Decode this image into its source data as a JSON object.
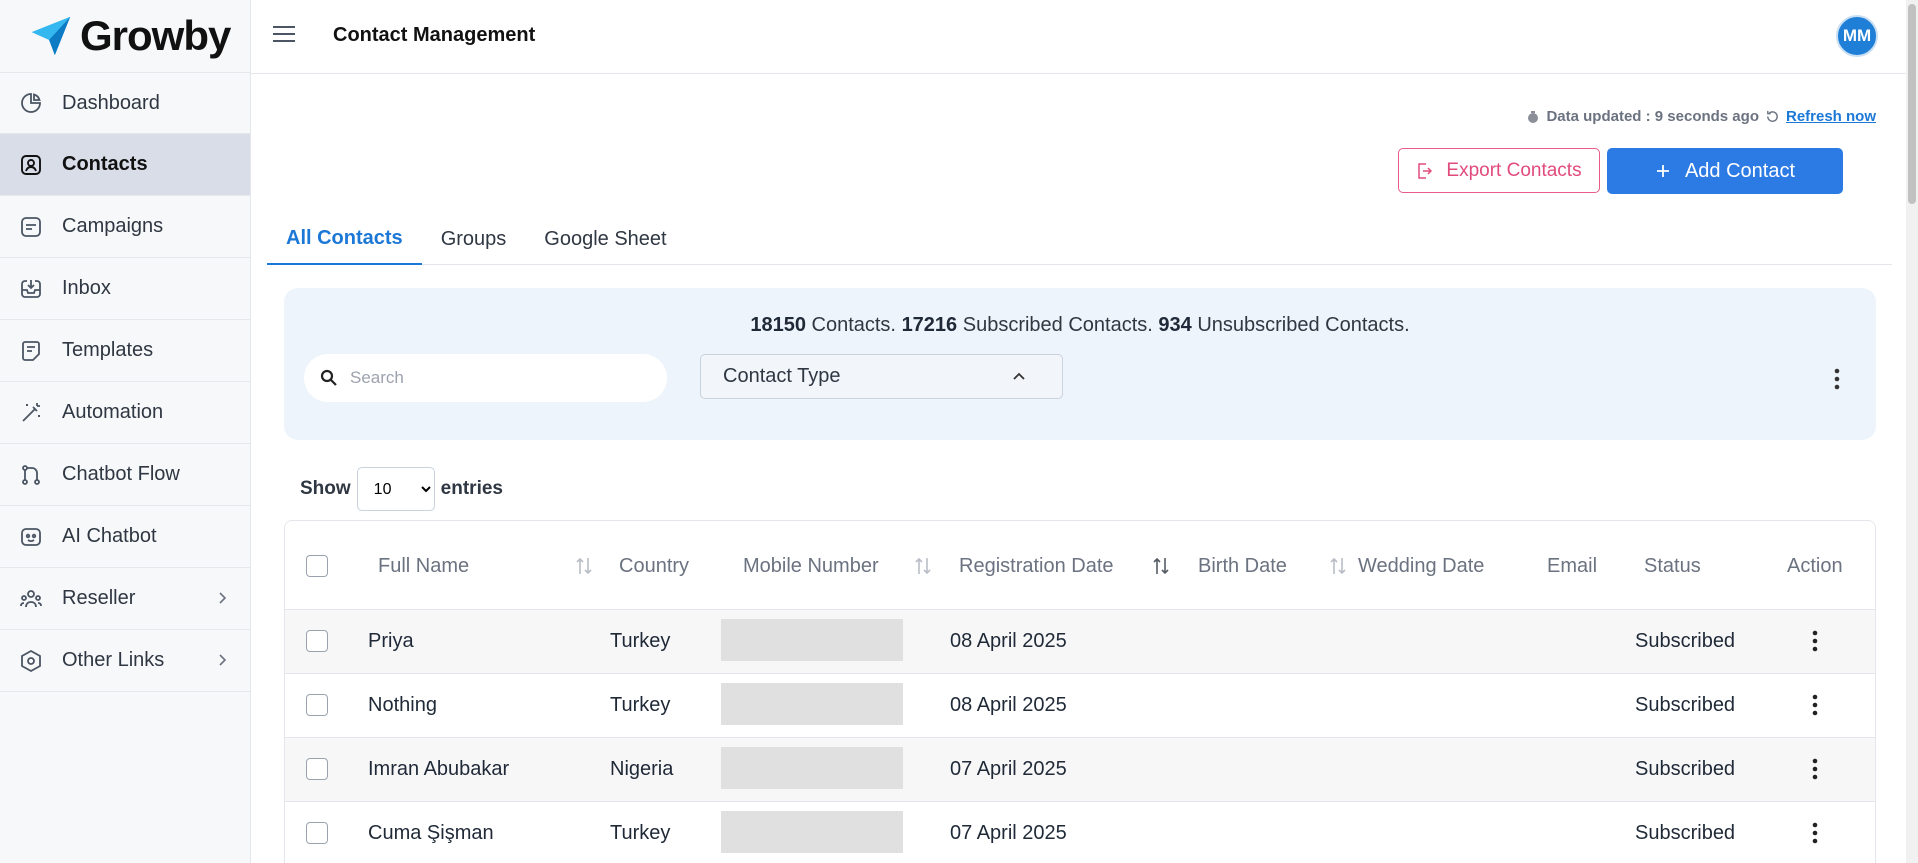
{
  "brand": {
    "name": "Growby"
  },
  "sidebar": {
    "items": [
      {
        "label": "Dashboard",
        "icon": "pie-chart-icon",
        "active": false,
        "has_submenu": false
      },
      {
        "label": "Contacts",
        "icon": "contact-card-icon",
        "active": true,
        "has_submenu": false
      },
      {
        "label": "Campaigns",
        "icon": "campaign-icon",
        "active": false,
        "has_submenu": false
      },
      {
        "label": "Inbox",
        "icon": "inbox-icon",
        "active": false,
        "has_submenu": false
      },
      {
        "label": "Templates",
        "icon": "template-icon",
        "active": false,
        "has_submenu": false
      },
      {
        "label": "Automation",
        "icon": "magic-wand-icon",
        "active": false,
        "has_submenu": false
      },
      {
        "label": "Chatbot Flow",
        "icon": "flow-icon",
        "active": false,
        "has_submenu": false
      },
      {
        "label": "AI Chatbot",
        "icon": "robot-icon",
        "active": false,
        "has_submenu": false
      },
      {
        "label": "Reseller",
        "icon": "users-icon",
        "active": false,
        "has_submenu": true
      },
      {
        "label": "Other Links",
        "icon": "hexagon-icon",
        "active": false,
        "has_submenu": true
      }
    ]
  },
  "header": {
    "title": "Contact Management",
    "avatar_initials": "MM"
  },
  "status": {
    "updated_text": "Data updated : 9 seconds ago",
    "refresh_label": "Refresh now"
  },
  "actions": {
    "export_label": "Export Contacts",
    "add_label": "Add Contact"
  },
  "tabs": [
    {
      "label": "All Contacts",
      "active": true
    },
    {
      "label": "Groups",
      "active": false
    },
    {
      "label": "Google Sheet",
      "active": false
    }
  ],
  "summary": {
    "total": "18150",
    "total_label": " Contacts. ",
    "subscribed": "17216",
    "subscribed_label": " Subscribed Contacts. ",
    "unsubscribed": "934",
    "unsubscribed_label": " Unsubscribed Contacts."
  },
  "search": {
    "placeholder": "Search",
    "value": ""
  },
  "contact_type": {
    "label": "Contact Type"
  },
  "entries": {
    "show_label": "Show",
    "value": "10",
    "entries_label": "entries"
  },
  "table": {
    "columns": [
      "Full Name",
      "Country",
      "Mobile Number",
      "Registration Date",
      "Birth Date",
      "Wedding Date",
      "Email",
      "Status",
      "Action"
    ],
    "rows": [
      {
        "name": "Priya",
        "country": "Turkey",
        "registration": "08 April 2025",
        "status": "Subscribed"
      },
      {
        "name": "Nothing",
        "country": "Turkey",
        "registration": "08 April 2025",
        "status": "Subscribed"
      },
      {
        "name": "Imran Abubakar",
        "country": "Nigeria",
        "registration": "07 April 2025",
        "status": "Subscribed"
      },
      {
        "name": "Cuma Şişman",
        "country": "Turkey",
        "registration": "07 April 2025",
        "status": "Subscribed"
      }
    ]
  },
  "colors": {
    "accent": "#2c7be5",
    "export": "#e14b7c",
    "panel": "#eef4fb",
    "active_nav": "#d9dde8"
  }
}
